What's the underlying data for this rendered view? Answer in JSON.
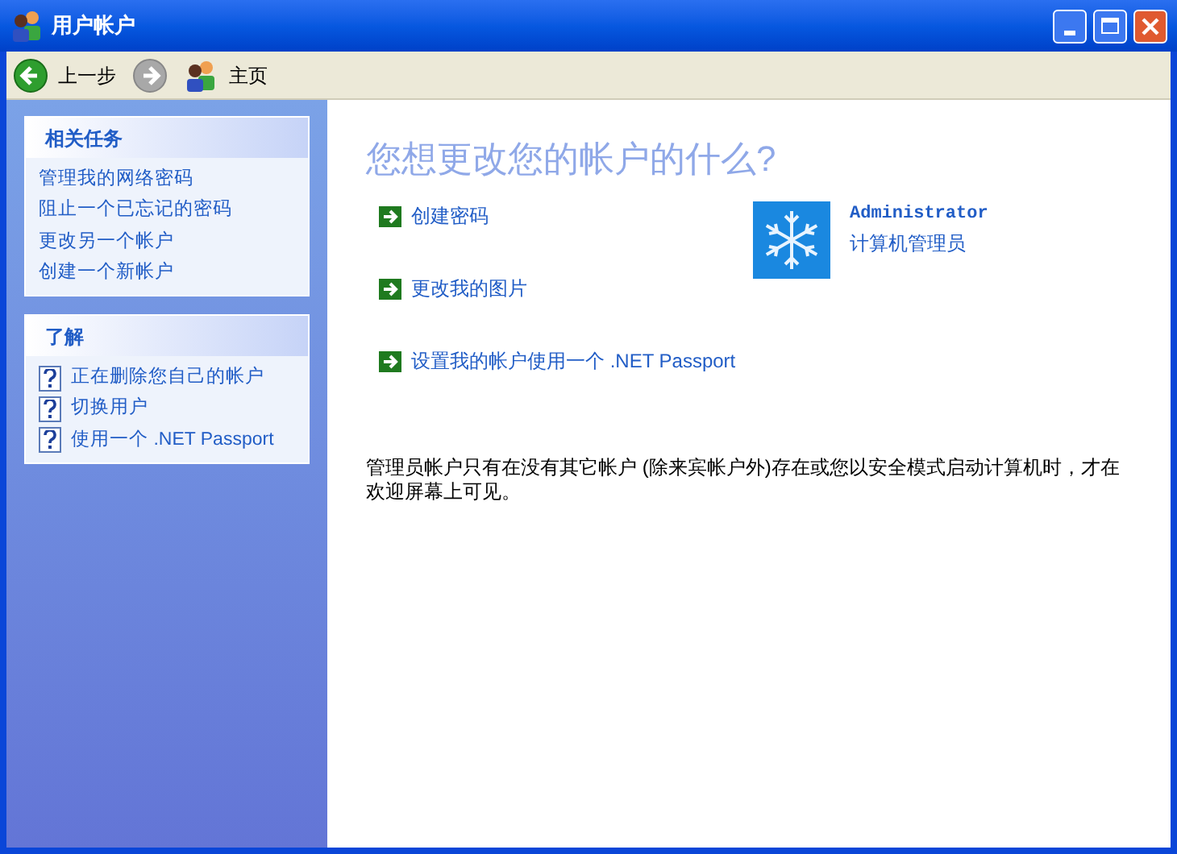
{
  "window": {
    "title": "用户帐户"
  },
  "toolbar": [
    {
      "kind": "back",
      "label": "上一步",
      "disabled": false
    },
    {
      "kind": "forward",
      "disabled": true
    },
    {
      "kind": "home",
      "label": "主页",
      "disabled": false
    }
  ],
  "sidebar": [
    {
      "title": "相关任务",
      "items": [
        {
          "kind": "link",
          "label": "管理我的网络密码"
        },
        {
          "kind": "link",
          "label": "阻止一个已忘记的密码"
        },
        {
          "kind": "link",
          "label": "更改另一个帐户"
        },
        {
          "kind": "link",
          "label": "创建一个新帐户"
        }
      ]
    },
    {
      "title": "了解",
      "items": [
        {
          "kind": "help",
          "label": "正在删除您自己的帐户"
        },
        {
          "kind": "help",
          "label": "切换用户"
        },
        {
          "kind": "help",
          "label": "使用一个 .NET Passport"
        }
      ]
    }
  ],
  "main": {
    "heading": "您想更改您的帐户的什么?",
    "tasks": [
      "创建密码",
      "更改我的图片",
      "设置我的帐户使用一个 .NET Passport"
    ],
    "account": {
      "name": "Administrator",
      "role": "计算机管理员"
    },
    "note": "管理员帐户只有在没有其它帐户 (除来宾帐户外)存在或您以安全模式启动计算机时，才在欢迎屏幕上可见。"
  }
}
